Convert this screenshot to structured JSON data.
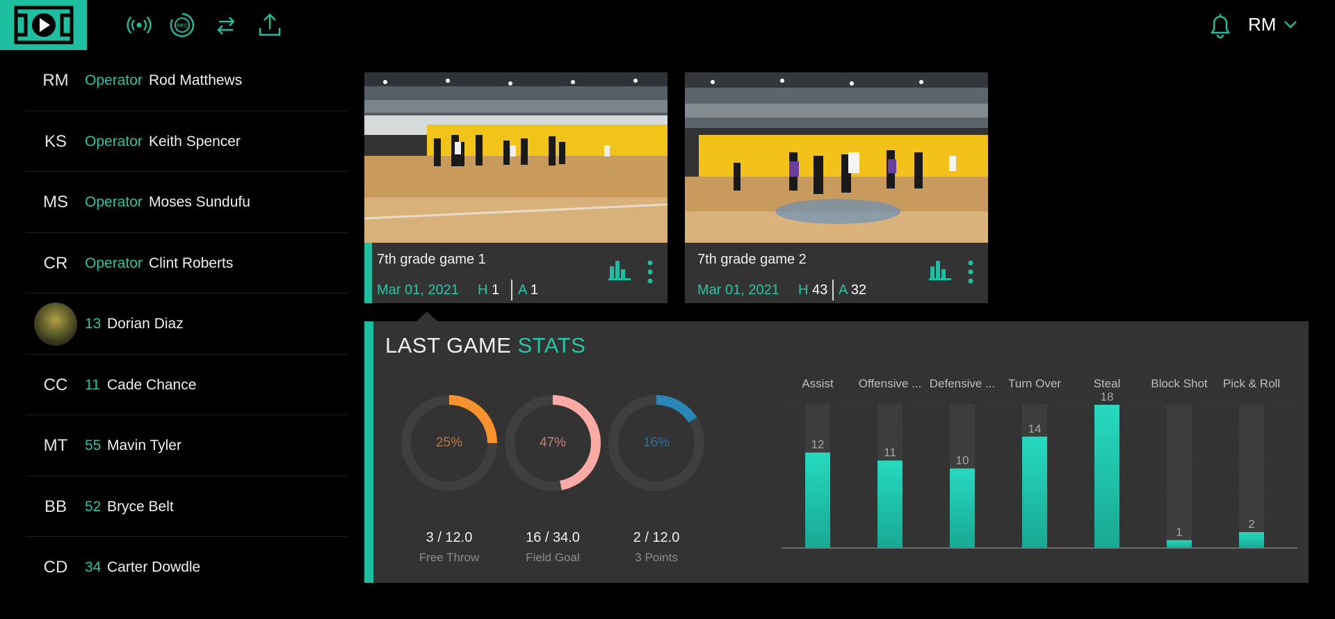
{
  "topbar": {
    "icons": [
      "court-logo-icon",
      "broadcast-icon",
      "record-icon",
      "swap-icon",
      "upload-icon"
    ],
    "record_text": "REC",
    "user_initials": "RM",
    "bell_icon": "bell-icon",
    "chevron_icon": "chevron-down-icon"
  },
  "colors": {
    "accent": "#1dbfa0",
    "free_throw": "#f7922e",
    "field_goal": "#fbaaa6",
    "three_points": "#2b86b8",
    "panel": "#333333"
  },
  "sidebar": {
    "people": [
      {
        "initials": "RM",
        "role": "Operator",
        "name": "Rod Matthews"
      },
      {
        "initials": "KS",
        "role": "Operator",
        "name": "Keith Spencer"
      },
      {
        "initials": "MS",
        "role": "Operator",
        "name": "Moses Sundufu"
      },
      {
        "initials": "CR",
        "role": "Operator",
        "name": "Clint Roberts"
      },
      {
        "initials": "",
        "role": "13",
        "name": "Dorian Diaz",
        "avatar": true
      },
      {
        "initials": "CC",
        "role": "11",
        "name": "Cade Chance"
      },
      {
        "initials": "MT",
        "role": "55",
        "name": "Mavin Tyler"
      },
      {
        "initials": "BB",
        "role": "52",
        "name": "Bryce Belt"
      },
      {
        "initials": "CD",
        "role": "34",
        "name": "Carter Dowdle"
      }
    ]
  },
  "games": [
    {
      "title": "7th grade game 1",
      "date": "Mar 01, 2021",
      "home_label": "H",
      "home": "1",
      "away_label": "A",
      "away": "1"
    },
    {
      "title": "7th grade game 2",
      "date": "Mar 01, 2021",
      "home_label": "H",
      "home": "43",
      "away_label": "A",
      "away": "32"
    }
  ],
  "stats": {
    "title_a": "LAST GAME",
    "title_b": "STATS",
    "donuts": [
      {
        "percent_text": "25%",
        "fraction": 0.25,
        "ratio": "3 / 12.0",
        "label": "Free Throw",
        "color": "#f7922e",
        "text_color": "#c3743a"
      },
      {
        "percent_text": "47%",
        "fraction": 0.47,
        "ratio": "16 / 34.0",
        "label": "Field Goal",
        "color": "#fbaaa6",
        "text_color": "#c0807e"
      },
      {
        "percent_text": "16%",
        "fraction": 0.16,
        "ratio": "2 / 12.0",
        "label": "3 Points",
        "color": "#2b86b8",
        "text_color": "#2a6f97"
      }
    ]
  },
  "chart_data": {
    "type": "bar",
    "categories": [
      "Assist",
      "Offensive ...",
      "Defensive ...",
      "Turn Over",
      "Steal",
      "Block Shot",
      "Pick & Roll"
    ],
    "values": [
      12,
      11,
      10,
      14,
      18,
      1,
      2
    ],
    "ylim": [
      0,
      18
    ],
    "grid": true,
    "bar_color": "#26d9bf"
  }
}
